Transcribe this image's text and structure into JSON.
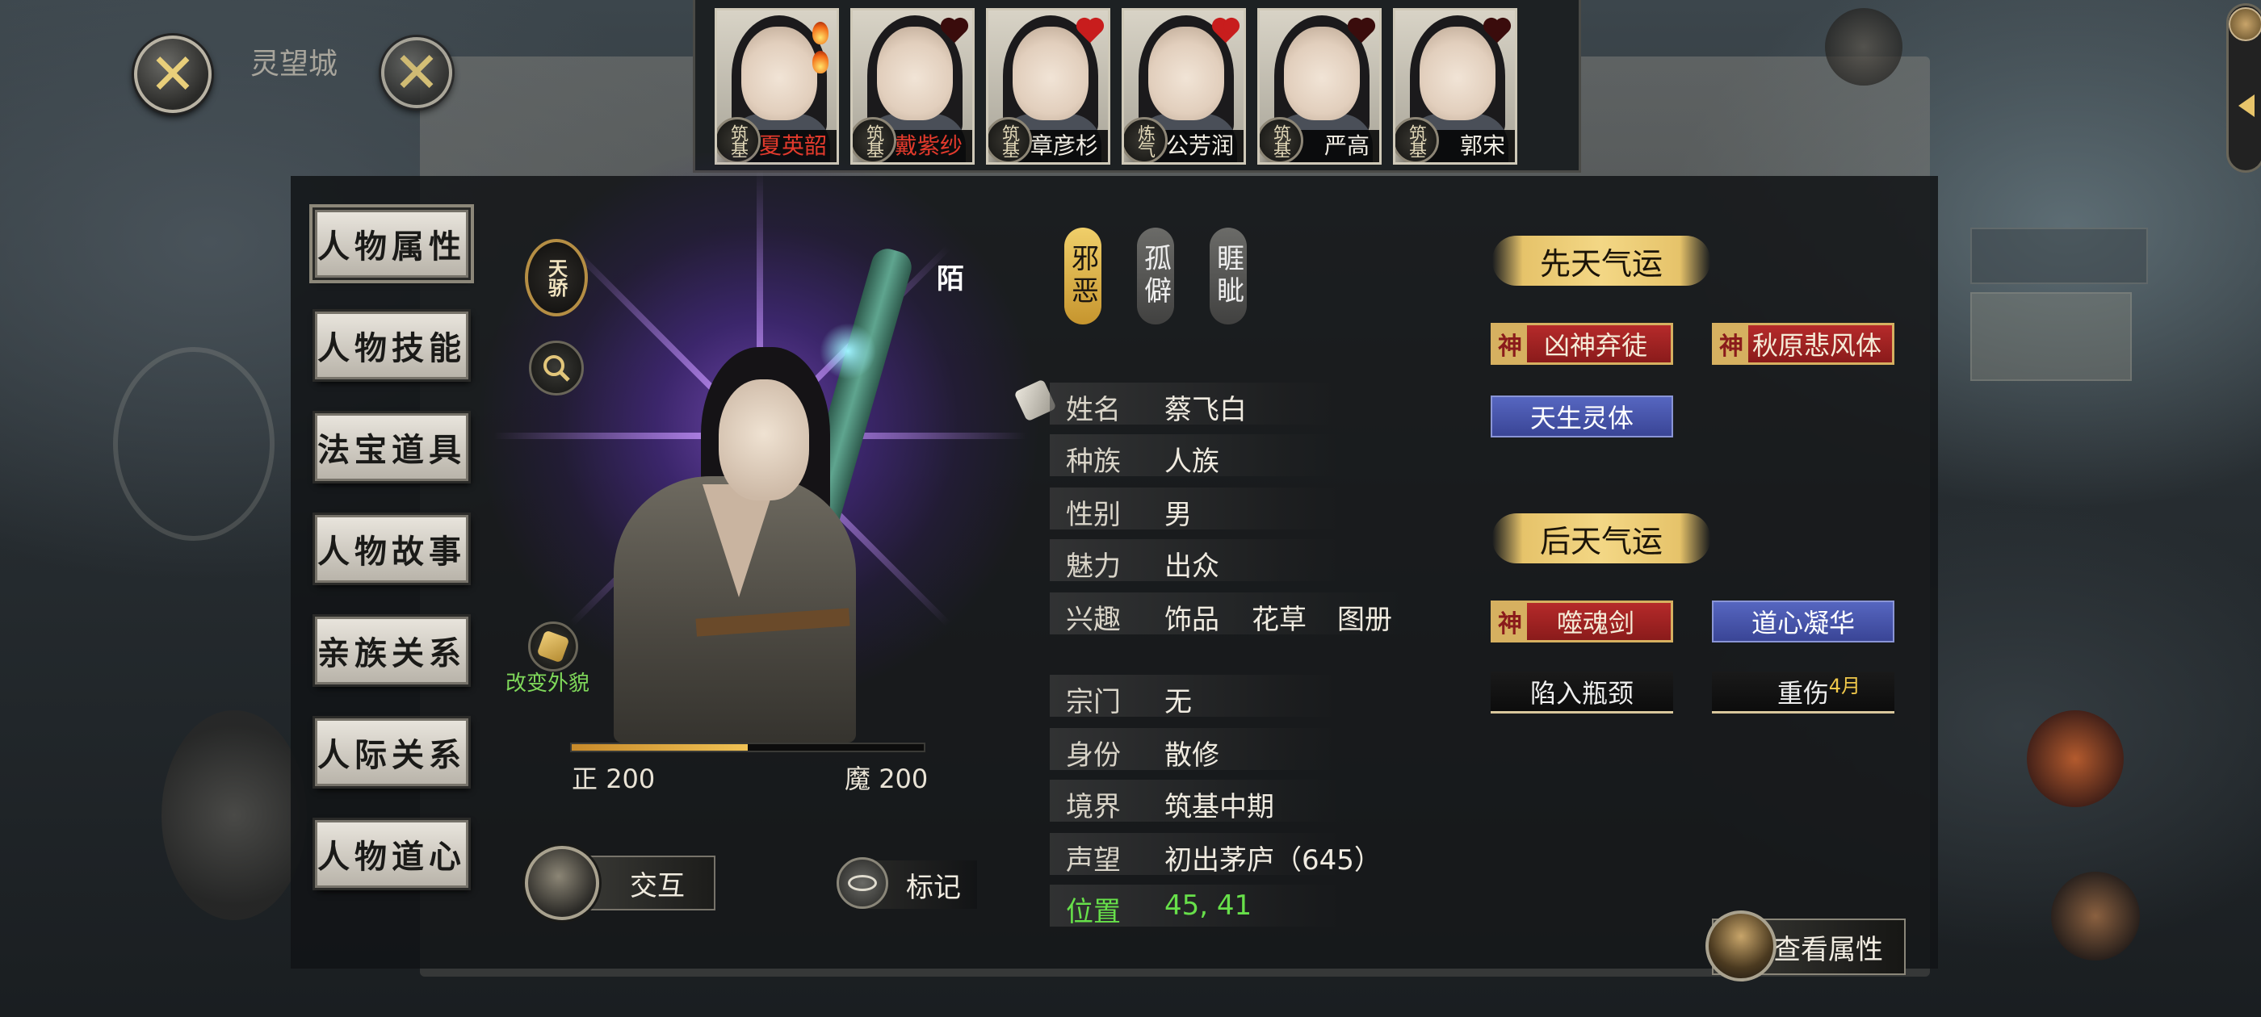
{
  "topbar": {
    "close_icon": "close-x-icon",
    "back_close_icon": "close-x-icon",
    "top_label": "灵望城"
  },
  "npc_strip": [
    {
      "name": "夏英韶",
      "rank": "筑基",
      "name_red": true,
      "heart": "flame"
    },
    {
      "name": "戴紫纱",
      "rank": "筑基",
      "name_red": true,
      "heart": "dark"
    },
    {
      "name": "章彦杉",
      "rank": "筑基",
      "name_red": false,
      "heart": "red"
    },
    {
      "name": "公芳润",
      "rank": "炼气",
      "name_red": false,
      "heart": "red"
    },
    {
      "name": "严高",
      "rank": "筑基",
      "name_red": false,
      "heart": "dark"
    },
    {
      "name": "郭宋",
      "rank": "筑基",
      "name_red": false,
      "heart": "dark"
    }
  ],
  "menu": [
    {
      "label": "人物属性",
      "active": true
    },
    {
      "label": "人物技能"
    },
    {
      "label": "法宝道具"
    },
    {
      "label": "人物故事"
    },
    {
      "label": "亲族关系"
    },
    {
      "label": "人际关系"
    },
    {
      "label": "人物道心"
    }
  ],
  "character": {
    "badge": "天骄",
    "relation": "陌",
    "change_look": "改变外貌",
    "righteous_label": "正",
    "righteous_value": "200",
    "demonic_label": "魔",
    "demonic_value": "200",
    "alignment_fill_fraction": 0.5
  },
  "traits": [
    {
      "label": "邪恶",
      "style": "gold"
    },
    {
      "label": "孤僻",
      "style": "grey"
    },
    {
      "label": "睚眦",
      "style": "grey"
    }
  ],
  "info": {
    "name": {
      "key": "姓名",
      "value": "蔡飞白"
    },
    "race": {
      "key": "种族",
      "value": "人族"
    },
    "gender": {
      "key": "性别",
      "value": "男"
    },
    "charm": {
      "key": "魅力",
      "value": "出众"
    },
    "hobby": {
      "key": "兴趣",
      "values": [
        "饰品",
        "花草",
        "图册"
      ]
    },
    "sect": {
      "key": "宗门",
      "value": "无"
    },
    "identity": {
      "key": "身份",
      "value": "散修"
    },
    "realm": {
      "key": "境界",
      "value": "筑基中期"
    },
    "reputation": {
      "key": "声望",
      "value": "初出茅庐（645）"
    },
    "position": {
      "key": "位置",
      "value": "45, 41"
    }
  },
  "luck": {
    "innate_title": "先天气运",
    "innate": [
      {
        "label": "凶神弃徒",
        "style": "red",
        "mark": "神"
      },
      {
        "label": "秋原悲风体",
        "style": "red",
        "mark": "神"
      },
      {
        "label": "天生灵体",
        "style": "blue"
      }
    ],
    "acquired_title": "后天气运",
    "acquired": [
      {
        "label": "噬魂剑",
        "style": "red",
        "mark": "神"
      },
      {
        "label": "道心凝华",
        "style": "blue"
      },
      {
        "label": "陷入瓶颈",
        "style": "dark"
      },
      {
        "label": "重伤",
        "style": "dark",
        "month": "4月"
      }
    ]
  },
  "actions": {
    "interact": "交互",
    "mark": "标记",
    "view_attributes": "查看属性"
  }
}
